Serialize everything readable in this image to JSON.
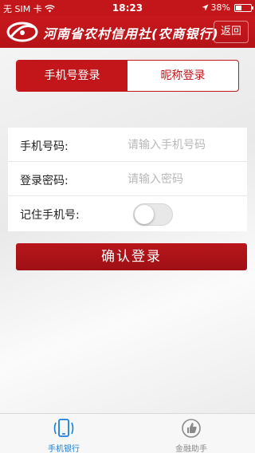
{
  "status_bar": {
    "carrier": "无 SIM 卡",
    "time": "18:23",
    "battery_percent": "38%",
    "battery_level": 0.38
  },
  "header": {
    "title": "河南省农村信用社(农商银行)",
    "back_label": "返回"
  },
  "login_tabs": [
    {
      "label": "手机号登录",
      "active": true
    },
    {
      "label": "昵称登录",
      "active": false
    }
  ],
  "form": {
    "phone": {
      "label": "手机号码:",
      "placeholder": "请输入手机号码",
      "value": ""
    },
    "password": {
      "label": "登录密码:",
      "placeholder": "请输入密码",
      "value": ""
    },
    "remember": {
      "label": "记住手机号:",
      "checked": false
    }
  },
  "confirm_label": "确认登录",
  "tabbar": [
    {
      "label": "手机银行",
      "icon": "phone-icon",
      "active": true
    },
    {
      "label": "金融助手",
      "icon": "thumbs-up-icon",
      "active": false
    }
  ],
  "colors": {
    "brand_red": "#c2161b",
    "tab_active_blue": "#1a7fd8"
  }
}
